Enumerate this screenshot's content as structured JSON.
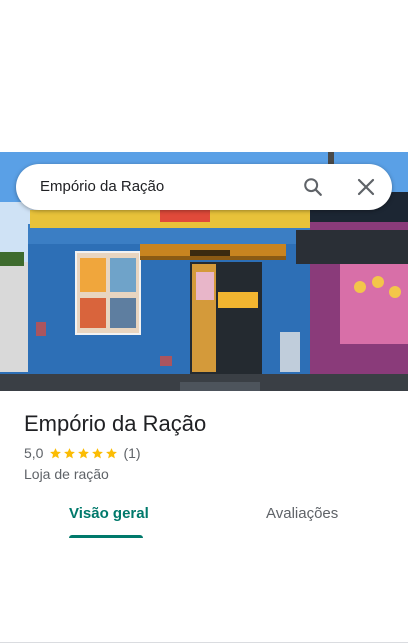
{
  "search": {
    "query": "Empório da Ração"
  },
  "place": {
    "title": "Empório da Ração",
    "rating": "5,0",
    "rating_value": 5.0,
    "reviews_count": "(1)",
    "category": "Loja de ração"
  },
  "tabs": [
    {
      "label": "Visão geral",
      "selected": true
    },
    {
      "label": "Avaliações",
      "selected": false
    }
  ],
  "colors": {
    "accent": "#00796b",
    "star": "#fbbc04",
    "wall_blue": "#2d6fb6",
    "awning": "#c88420"
  },
  "icons": {
    "search": "search-icon",
    "close": "close-icon",
    "star": "star-icon"
  }
}
